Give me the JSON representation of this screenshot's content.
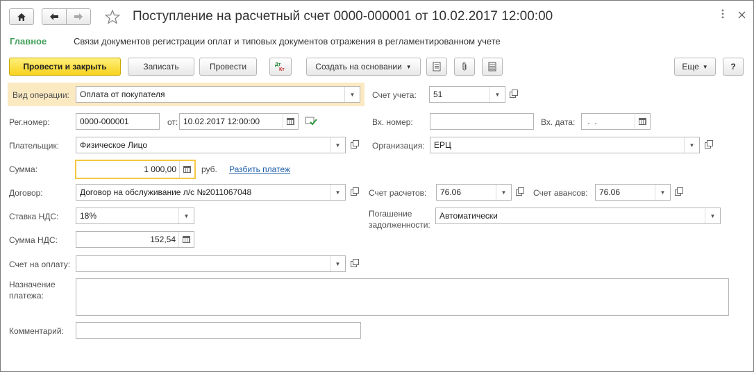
{
  "window": {
    "title": "Поступление на расчетный счет 0000-000001 от 10.02.2017 12:00:00",
    "more_icon": "more-vert-icon",
    "close_icon": "close-icon"
  },
  "nav": {
    "main": "Главное",
    "related": "Связи документов регистрации оплат и типовых документов отражения в регламентированном учете"
  },
  "toolbar": {
    "post_close": "Провести и закрыть",
    "save": "Записать",
    "post": "Провести",
    "dtkt_icon": "Дт Кт",
    "create_based": "Создать на основании",
    "more": "Еще",
    "help": "?"
  },
  "form": {
    "operation_label": "Вид операции:",
    "operation_value": "Оплата от покупателя",
    "account_label": "Счет учета:",
    "account_value": "51",
    "regnum_label": "Рег.номер:",
    "regnum_value": "0000-000001",
    "date_from_label": "от:",
    "date_value": "10.02.2017 12:00:00",
    "in_number_label": "Вх. номер:",
    "in_number_value": "",
    "in_date_label": "Вх. дата:",
    "in_date_value": " .  .",
    "payer_label": "Плательщик:",
    "payer_value": "Физическое Лицо",
    "org_label": "Организация:",
    "org_value": "ЕРЦ",
    "sum_label": "Сумма:",
    "sum_value": "1 000,00",
    "currency": "руб.",
    "split_link": "Разбить платеж",
    "contract_label": "Договор:",
    "contract_value": "Договор на обслуживание л/с №2011067048",
    "settle_label": "Счет расчетов:",
    "settle_value": "76.06",
    "advance_label": "Счет авансов:",
    "advance_value": "76.06",
    "vat_rate_label": "Ставка НДС:",
    "vat_rate_value": "18%",
    "debt_label_1": "Погашение",
    "debt_label_2": "задолженности:",
    "debt_value": "Автоматически",
    "vat_sum_label": "Сумма НДС:",
    "vat_sum_value": "152,54",
    "invoice_label": "Счет на оплату:",
    "invoice_value": "",
    "purpose_label_1": "Назначение",
    "purpose_label_2": "платежа:",
    "purpose_value": "",
    "comment_label": "Комментарий:",
    "comment_value": ""
  },
  "colors": {
    "accent_green": "#41a05a",
    "primary_button": "#f8d21e",
    "highlight_row": "#fbe9c2",
    "link": "#1f5fa8"
  }
}
